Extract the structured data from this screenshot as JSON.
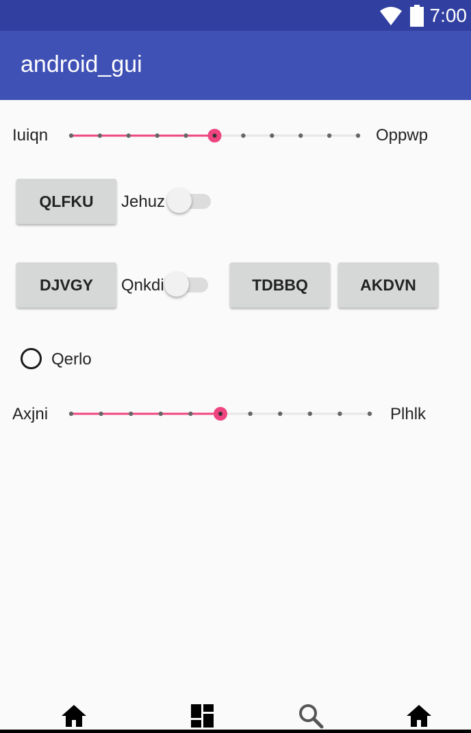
{
  "status_bar": {
    "time": "7:00",
    "icons": [
      "wifi-icon",
      "battery-icon"
    ]
  },
  "app_bar": {
    "title": "android_gui"
  },
  "slider1": {
    "left_label": "Iuiqn",
    "right_label": "Oppwp",
    "steps": 10,
    "value": 5
  },
  "row1": {
    "button_label": "QLFKU",
    "switch_label": "Jehuz",
    "switch_on": false
  },
  "row2": {
    "button1_label": "DJVGY",
    "switch_label": "Qnkdi",
    "switch_on": false,
    "button2_label": "TDBBQ",
    "button3_label": "AKDVN"
  },
  "radio": {
    "label": "Qerlo",
    "checked": false
  },
  "slider2": {
    "left_label": "Axjni",
    "right_label": "Plhlk",
    "steps": 10,
    "value": 5
  },
  "bottom_nav": {
    "icons": [
      "home-icon",
      "dashboard-icon",
      "search-icon",
      "home-icon"
    ]
  },
  "colors": {
    "primary": "#3f51b5",
    "primary_dark": "#3140a0",
    "accent": "#ee4580"
  }
}
